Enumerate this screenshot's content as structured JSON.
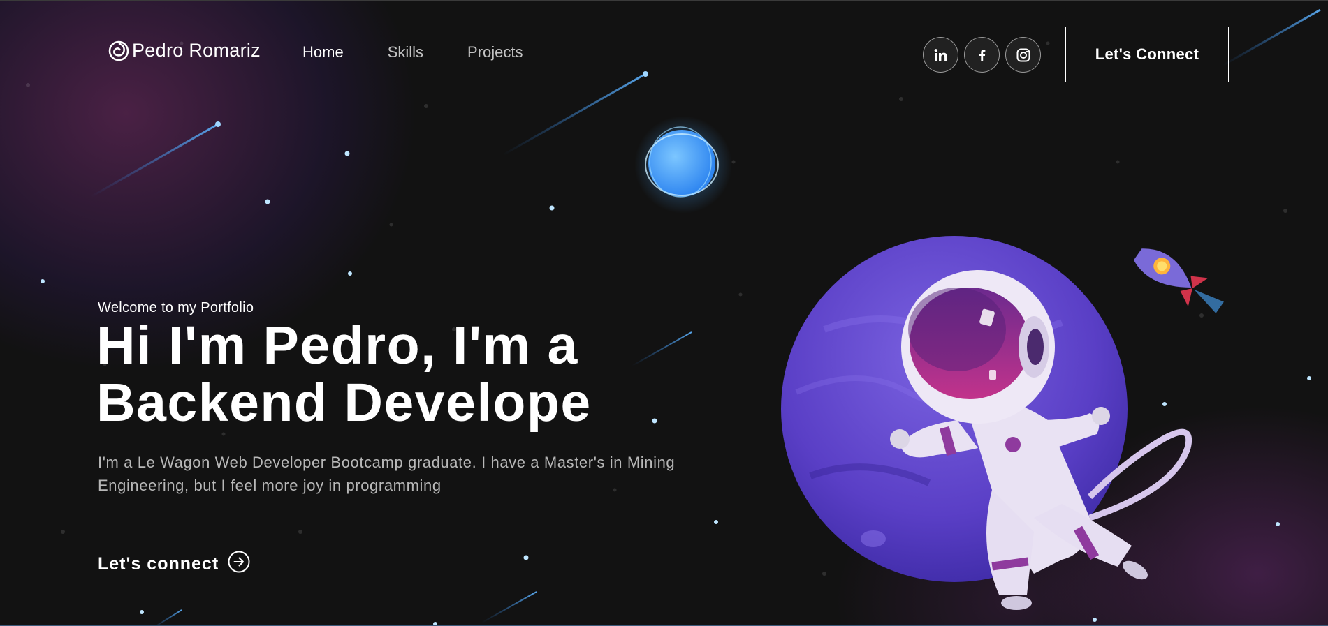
{
  "nav": {
    "logo_text": "Pedro Romariz",
    "links": [
      {
        "label": "Home",
        "active": true
      },
      {
        "label": "Skills",
        "active": false
      },
      {
        "label": "Projects",
        "active": false
      }
    ],
    "socials": [
      {
        "icon": "linkedin-icon"
      },
      {
        "icon": "facebook-icon"
      },
      {
        "icon": "instagram-icon"
      }
    ],
    "connect_button": "Let's Connect"
  },
  "hero": {
    "tagline": "Welcome to my Portfolio",
    "headline": "Hi I'm Pedro, I'm a Backend Develope",
    "intro": "I'm a Le Wagon Web Developer Bootcamp graduate. I have a Master's in Mining Engineering, but I feel more joy in programming",
    "cta_label": "Let's connect",
    "cta_icon": "arrow-right-circle-icon"
  },
  "illustration": {
    "items": [
      "astronaut",
      "purple-planet",
      "blue-moon",
      "rocket",
      "shooting-stars"
    ]
  },
  "colors": {
    "background": "#121212",
    "planet": "#6a4fd1",
    "moon": "#4aa8ff",
    "star": "#bfe6ff"
  }
}
